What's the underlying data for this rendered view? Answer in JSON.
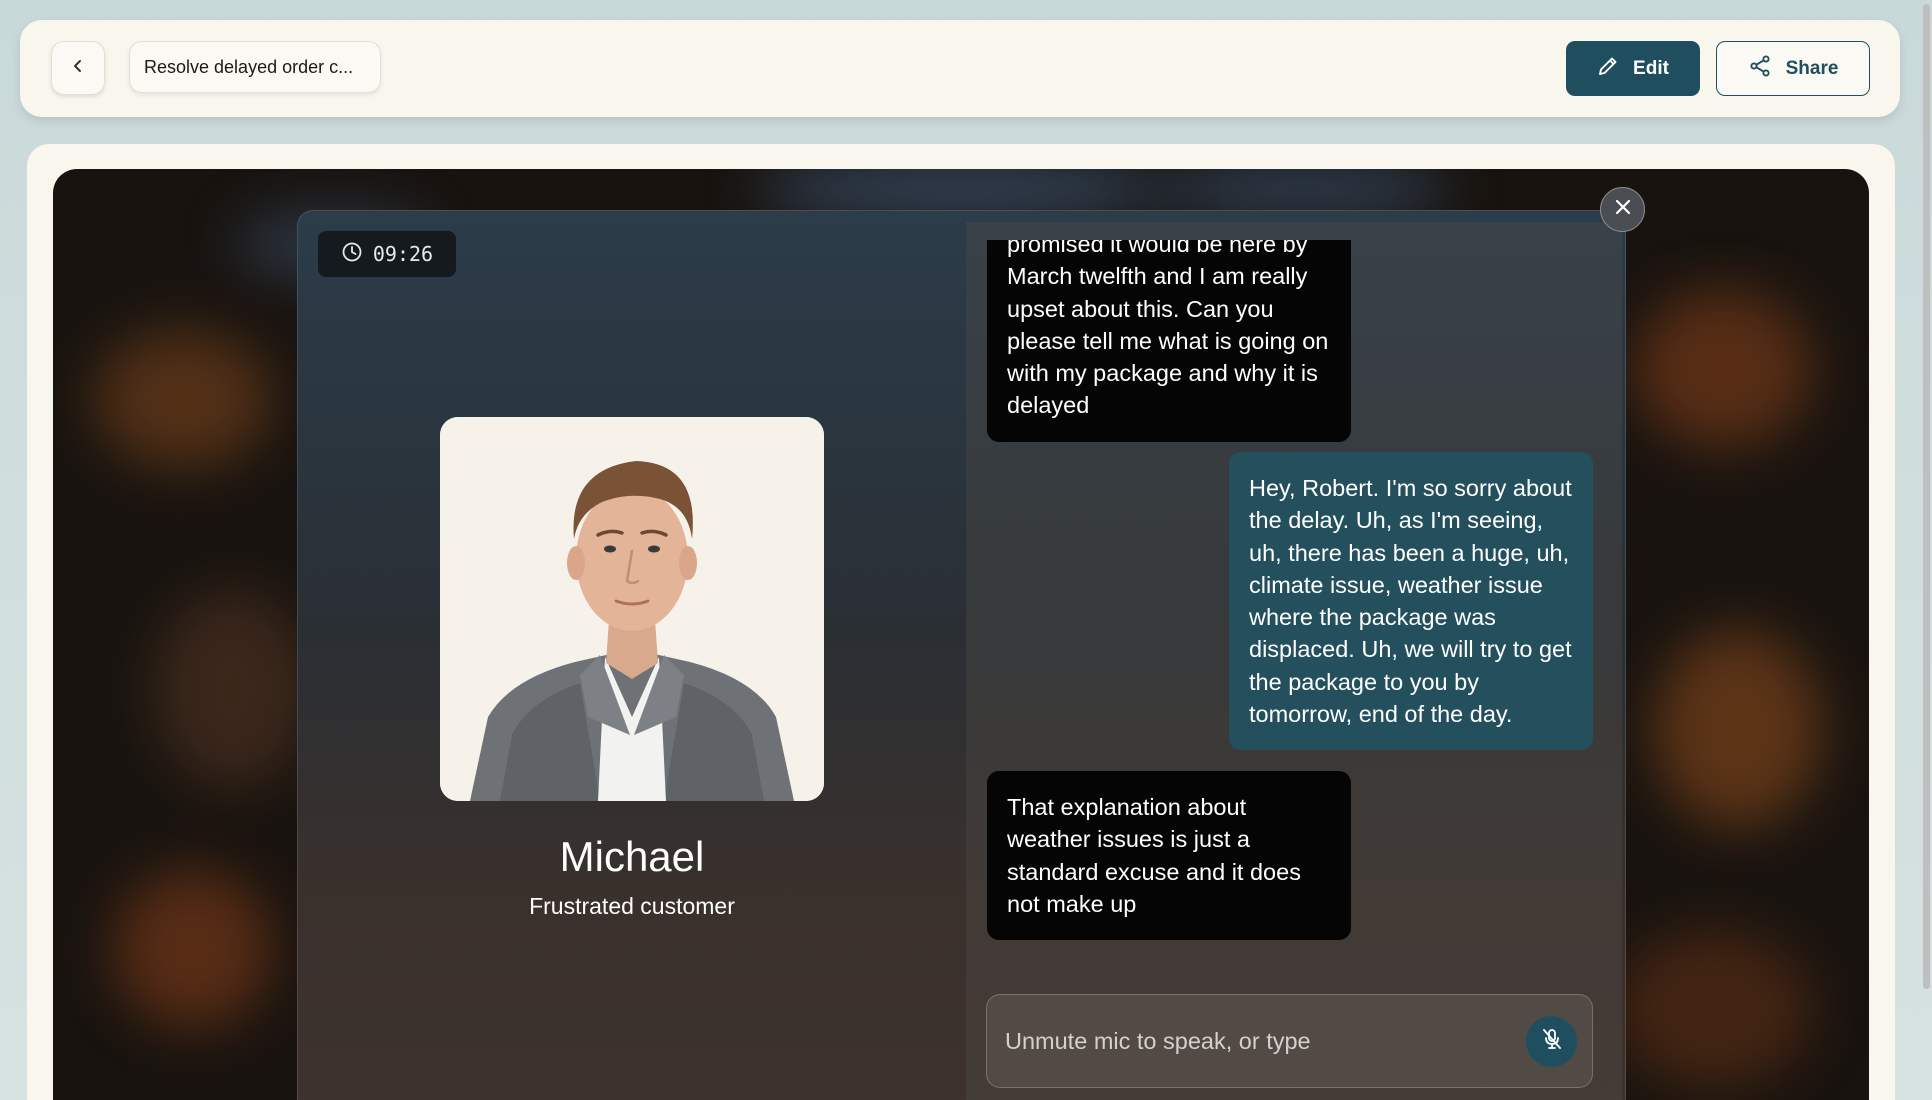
{
  "header": {
    "title": "Resolve delayed order c...",
    "edit_label": "Edit",
    "share_label": "Share"
  },
  "call": {
    "timer": "09:26",
    "persona": {
      "name": "Michael",
      "role": "Frustrated customer"
    },
    "transcript": [
      {
        "speaker": "ai",
        "text": "promised it would be here by March twelfth and I am really upset about this. Can you please tell me what is going on with my package and why it is delayed"
      },
      {
        "speaker": "user",
        "text": "Hey, Robert. I'm so sorry about the delay. Uh, as I'm seeing, uh, there has been a huge, uh, climate issue, weather issue where the package was displaced. Uh, we will try to get the package to you by tomorrow, end of the day."
      },
      {
        "speaker": "ai",
        "text": "That explanation about weather issues is just a standard excuse and it does not make up"
      }
    ],
    "composer": {
      "placeholder": "Unmute mic to speak, or type",
      "value": ""
    }
  },
  "icons": {
    "back": "chevron-left-icon",
    "edit": "pencil-icon",
    "share": "share-icon",
    "timer": "clock-icon",
    "close": "close-icon",
    "mic": "mic-off-icon"
  },
  "colors": {
    "accent": "#1f4f5f",
    "user_bubble": "#24505e",
    "ai_bubble": "#050505",
    "surface": "#f9f6ee"
  }
}
